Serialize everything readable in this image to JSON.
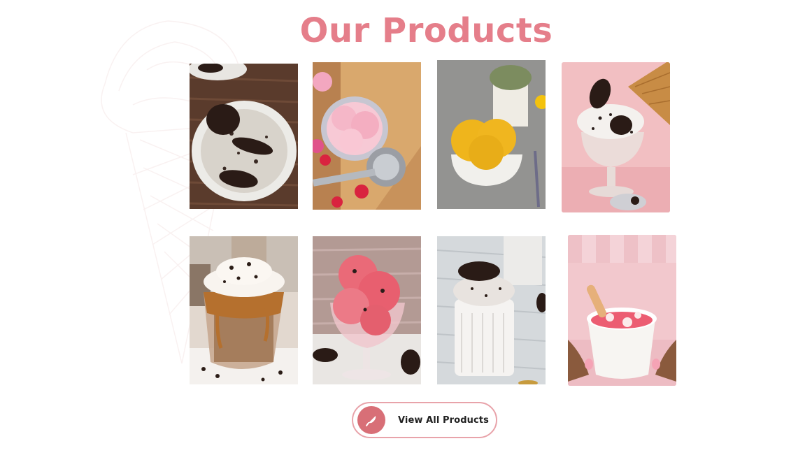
{
  "page": {
    "title": "Our Products",
    "accent_color": "#e57e8a"
  },
  "products": [
    {
      "image": "oreo-ice-cream-bowl"
    },
    {
      "image": "strawberry-ice-cream-bowl"
    },
    {
      "image": "mango-ice-cream-bowl"
    },
    {
      "image": "oreo-cone-sundae"
    },
    {
      "image": "caramel-oreo-shake"
    },
    {
      "image": "strawberry-sundae-glass"
    },
    {
      "image": "oreo-milkshake"
    },
    {
      "image": "pink-ice-cream-cup"
    }
  ],
  "cta": {
    "label": "View All Products",
    "icon": "ice-cream-cone-icon",
    "border_color": "#e8a3aa",
    "icon_bg_color": "#d86f77"
  }
}
